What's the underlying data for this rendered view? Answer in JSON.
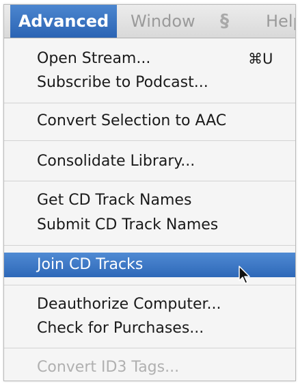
{
  "menubar": {
    "active_title": "Advanced",
    "window_title": "Window",
    "script_icon": "script-icon",
    "help_title": "Help"
  },
  "menu": {
    "items": [
      {
        "label": "Open Stream...",
        "shortcut": "⌘U"
      },
      {
        "label": "Subscribe to Podcast..."
      },
      {
        "label": "Convert Selection to AAC"
      },
      {
        "label": "Consolidate Library..."
      },
      {
        "label": "Get CD Track Names"
      },
      {
        "label": "Submit CD Track Names"
      },
      {
        "label": "Join CD Tracks",
        "state": "highlighted"
      },
      {
        "label": "Deauthorize Computer..."
      },
      {
        "label": "Check for Purchases..."
      },
      {
        "label": "Convert ID3 Tags...",
        "state": "disabled"
      }
    ]
  },
  "colors": {
    "highlight": "#2e68b8",
    "menu_background": "#f5f5f5",
    "disabled_text": "#b0b0b0"
  },
  "cursor": "arrow-cursor-icon"
}
